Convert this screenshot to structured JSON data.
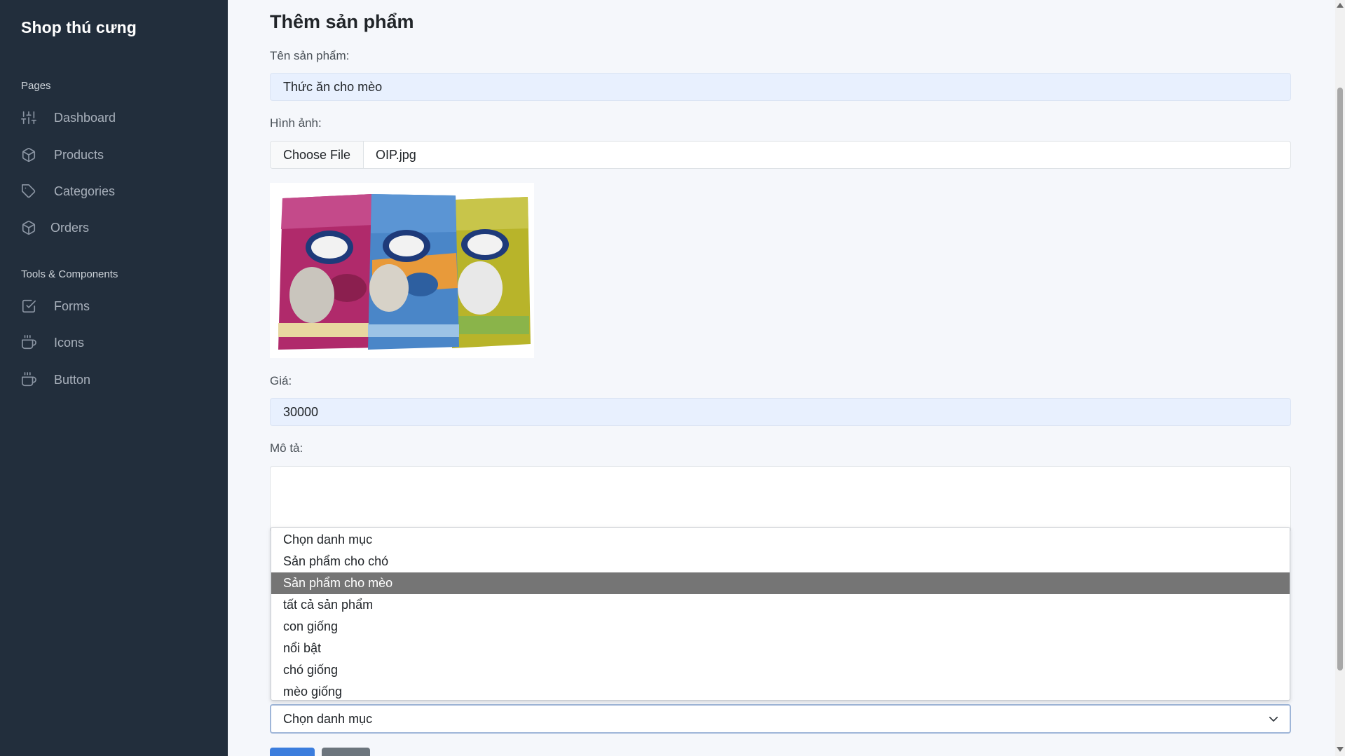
{
  "sidebar": {
    "brand": "Shop thú cưng",
    "section_pages": "Pages",
    "section_tools": "Tools & Components",
    "items": [
      {
        "label": "Dashboard",
        "icon": "sliders-icon"
      },
      {
        "label": "Products",
        "icon": "package-icon"
      },
      {
        "label": "Categories",
        "icon": "tag-icon"
      },
      {
        "label": "Orders",
        "icon": "package-icon"
      },
      {
        "label": "Forms",
        "icon": "check-square-icon"
      },
      {
        "label": "Icons",
        "icon": "coffee-icon"
      },
      {
        "label": "Button",
        "icon": "coffee-icon"
      }
    ]
  },
  "form": {
    "title": "Thêm sản phẩm",
    "name_label": "Tên sản phẩm:",
    "name_value": "Thức ăn cho mèo",
    "image_label": "Hình ảnh:",
    "file_button": "Choose File",
    "file_name": "OIP.jpg",
    "price_label": "Giá:",
    "price_value": "30000",
    "description_label": "Mô tả:",
    "description_value": "",
    "category_selected": "Chọn danh mục",
    "category_options": [
      "Chọn danh mục",
      "Sản phẩm cho chó",
      "Sản phẩm cho mèo",
      "tất cả sản phẩm",
      "con giống",
      "nổi bật",
      "chó giống",
      "mèo giống"
    ],
    "highlighted_option": "Sản phẩm cho mèo"
  },
  "colors": {
    "sidebar_bg": "#222e3c",
    "page_bg": "#f5f7fb",
    "primary": "#3b7ddd",
    "secondary": "#6c757d",
    "highlight": "#757575"
  }
}
